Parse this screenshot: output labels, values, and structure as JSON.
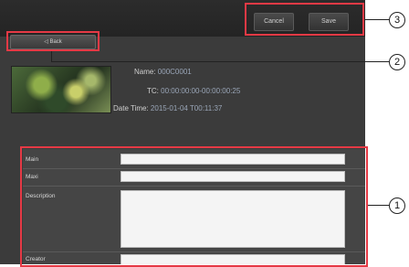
{
  "toolbar": {
    "cancel_label": "Cancel",
    "save_label": "Save",
    "back_label": "◁ Back"
  },
  "clip": {
    "name_label": "Name:",
    "name_value": "000C0001",
    "tc_label": "TC:",
    "tc_value": "00:00:00:00-00:00:00:25",
    "datetime_label": "Date Time:",
    "datetime_value": "2015-01-04 T00:11:37"
  },
  "form": {
    "field1_label": "Main",
    "field1_value": "",
    "field2_label": "Maxi",
    "field2_value": "",
    "description_label": "Description",
    "description_value": "",
    "creator_label": "Creator",
    "creator_value": ""
  },
  "callouts": [
    "1",
    "2",
    "3"
  ]
}
